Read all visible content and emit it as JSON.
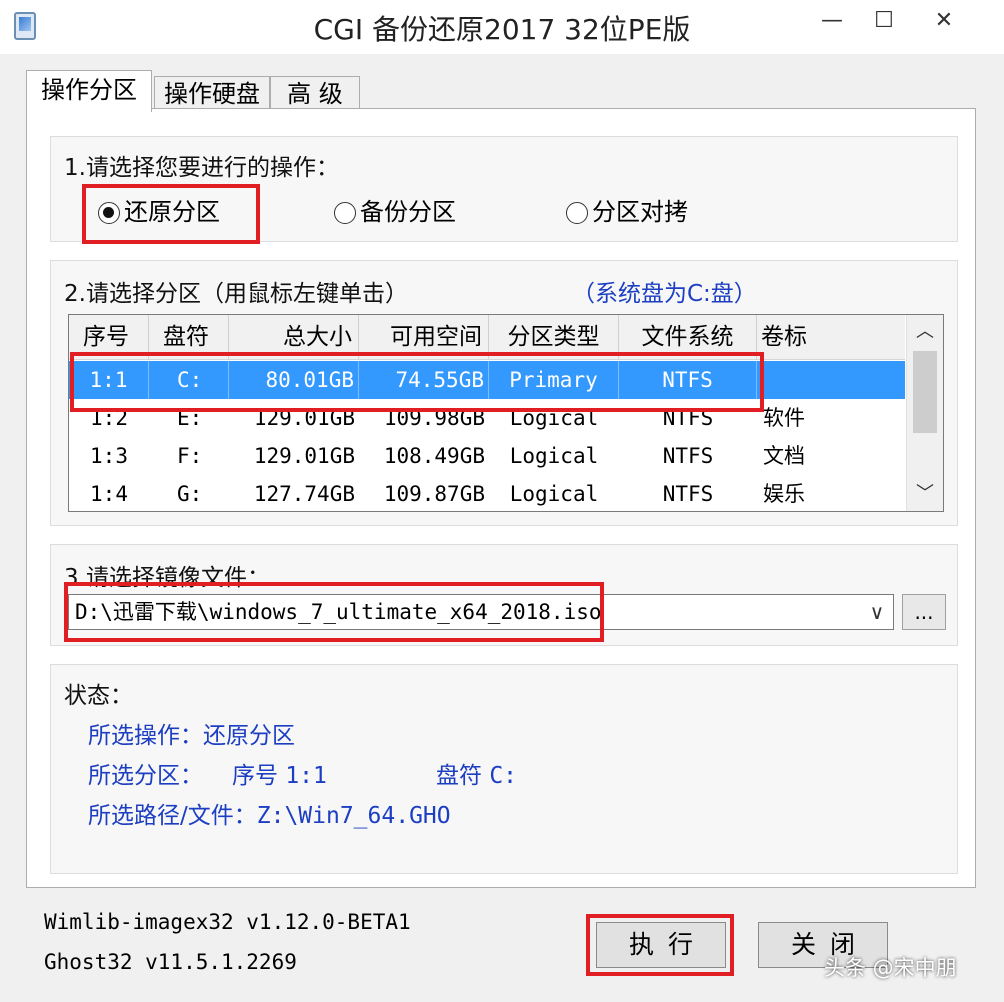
{
  "window": {
    "title": "CGI 备份还原2017 32位PE版",
    "minimize": "—",
    "maximize": "☐",
    "close": "✕"
  },
  "tabs": [
    {
      "label": "操作分区",
      "active": true
    },
    {
      "label": "操作硬盘",
      "active": false
    },
    {
      "label": "高 级",
      "active": false
    }
  ],
  "step1": {
    "label": "1.请选择您要进行的操作：",
    "options": [
      {
        "label": "还原分区",
        "selected": true
      },
      {
        "label": "备份分区",
        "selected": false
      },
      {
        "label": "分区对拷",
        "selected": false
      }
    ]
  },
  "step2": {
    "label": "2.请选择分区（用鼠标左键单击）",
    "note": "（系统盘为C:盘）",
    "columns": [
      "序号",
      "盘符",
      "总大小",
      "可用空间",
      "分区类型",
      "文件系统",
      "卷标"
    ],
    "rows": [
      {
        "index": "1:1",
        "drive": "C:",
        "total": "80.01GB",
        "free": "74.55GB",
        "type": "Primary",
        "fs": "NTFS",
        "label": "",
        "selected": true
      },
      {
        "index": "1:2",
        "drive": "E:",
        "total": "129.01GB",
        "free": "109.98GB",
        "type": "Logical",
        "fs": "NTFS",
        "label": "软件",
        "selected": false
      },
      {
        "index": "1:3",
        "drive": "F:",
        "total": "129.01GB",
        "free": "108.49GB",
        "type": "Logical",
        "fs": "NTFS",
        "label": "文档",
        "selected": false
      },
      {
        "index": "1:4",
        "drive": "G:",
        "total": "127.74GB",
        "free": "109.87GB",
        "type": "Logical",
        "fs": "NTFS",
        "label": "娱乐",
        "selected": false
      }
    ]
  },
  "step3": {
    "label": "3.请选择镜像文件：",
    "value": "D:\\迅雷下载\\windows_7_ultimate_x64_2018.iso",
    "browse": "..."
  },
  "status": {
    "label": "状态：",
    "op_label": "所选操作：",
    "op_value": "还原分区",
    "part_label": "所选分区：",
    "part_index_label": "序号",
    "part_index": "1:1",
    "part_drive_label": "盘符",
    "part_drive": "C:",
    "path_label": "所选路径/文件：",
    "path_value": "Z:\\Win7_64.GHO"
  },
  "versions": {
    "wimlib": "Wimlib-imagex32 v1.12.0-BETA1",
    "ghost": "Ghost32 v11.5.1.2269"
  },
  "buttons": {
    "execute": "执行",
    "close": "关闭"
  },
  "watermark": "头条 @宋中朋",
  "colors": {
    "highlight": "#e01e24",
    "selection": "#3399ff",
    "status_text": "#1c3ec2"
  }
}
